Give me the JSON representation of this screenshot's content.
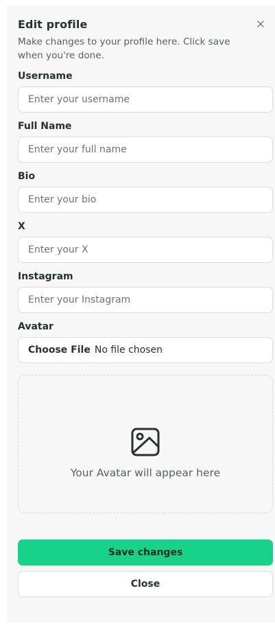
{
  "dialog": {
    "title": "Edit profile",
    "description": "Make changes to your profile here. Click save when you're done.",
    "close_icon": "close-icon"
  },
  "fields": {
    "username": {
      "label": "Username",
      "placeholder": "Enter your username",
      "value": ""
    },
    "full_name": {
      "label": "Full Name",
      "placeholder": "Enter your full name",
      "value": ""
    },
    "bio": {
      "label": "Bio",
      "placeholder": "Enter your bio",
      "value": ""
    },
    "x": {
      "label": "X",
      "placeholder": "Enter your X",
      "value": ""
    },
    "instagram": {
      "label": "Instagram",
      "placeholder": "Enter your Instagram",
      "value": ""
    },
    "avatar": {
      "label": "Avatar",
      "button_label": "Choose File",
      "status": "No file chosen"
    }
  },
  "avatar_preview": {
    "icon": "image-icon",
    "text": "Your Avatar will appear here"
  },
  "actions": {
    "save_label": "Save changes",
    "close_label": "Close"
  },
  "colors": {
    "accent": "#17d38a",
    "panel_bg": "#f6f7f6",
    "text": "#26332c",
    "muted": "#56625b",
    "border": "#d9ddd9"
  }
}
